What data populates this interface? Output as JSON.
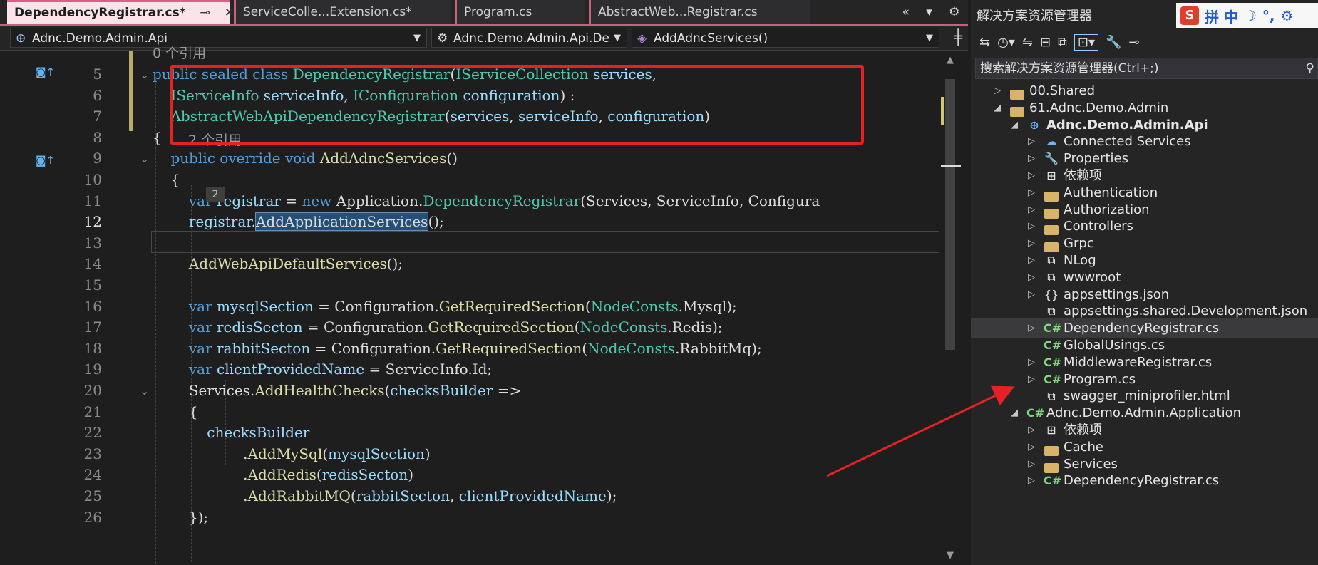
{
  "tabs": [
    {
      "label": "DependencyRegistrar.cs*",
      "active": true
    },
    {
      "label": "ServiceColle...Extension.cs*",
      "active": false
    },
    {
      "label": "Program.cs",
      "active": false
    },
    {
      "label": "AbstractWeb...Registrar.cs",
      "active": false
    }
  ],
  "nav": {
    "project": "Adnc.Demo.Admin.Api",
    "type": "Adnc.Demo.Admin.Api.De",
    "member": "AddAdncServices()"
  },
  "code": {
    "codelens_class": "0 个引用",
    "codelens_method": "2 个引用",
    "inline_hint": "2",
    "lines": [
      {
        "n": "5",
        "parts": [
          [
            "kw",
            "public sealed class "
          ],
          [
            "ty",
            "DependencyRegistrar"
          ],
          [
            "pl",
            "("
          ],
          [
            "ty",
            "IServiceCollection "
          ],
          [
            "id",
            "services"
          ],
          [
            "pl",
            ","
          ]
        ]
      },
      {
        "n": "6",
        "parts": [
          [
            "pl",
            "    "
          ],
          [
            "ty",
            "IServiceInfo "
          ],
          [
            "id",
            "serviceInfo"
          ],
          [
            "pl",
            ", "
          ],
          [
            "ty",
            "IConfiguration "
          ],
          [
            "id",
            "configuration"
          ],
          [
            "pl",
            ") :"
          ]
        ]
      },
      {
        "n": "7",
        "parts": [
          [
            "pl",
            "    "
          ],
          [
            "ty",
            "AbstractWebApiDependencyRegistrar"
          ],
          [
            "pl",
            "("
          ],
          [
            "id",
            "services"
          ],
          [
            "pl",
            ", "
          ],
          [
            "id",
            "serviceInfo"
          ],
          [
            "pl",
            ", "
          ],
          [
            "id",
            "configuration"
          ],
          [
            "pl",
            ")"
          ]
        ]
      },
      {
        "n": "8",
        "parts": [
          [
            "pl",
            "{"
          ]
        ]
      },
      {
        "n": "9",
        "parts": [
          [
            "pl",
            "    "
          ],
          [
            "kw",
            "public override void "
          ],
          [
            "mt",
            "AddAdncServices"
          ],
          [
            "pl",
            "()"
          ]
        ]
      },
      {
        "n": "10",
        "parts": [
          [
            "pl",
            "    {"
          ]
        ]
      },
      {
        "n": "11",
        "parts": [
          [
            "pl",
            "        "
          ],
          [
            "kw",
            "var "
          ],
          [
            "id",
            "registrar"
          ],
          [
            "pl",
            " = "
          ],
          [
            "kw",
            "new "
          ],
          [
            "pl",
            "Application."
          ],
          [
            "ty",
            "DependencyRegistrar"
          ],
          [
            "pl",
            "(Services, ServiceInfo, Configura"
          ]
        ]
      },
      {
        "n": "12",
        "parts": [
          [
            "pl",
            "        "
          ],
          [
            "id",
            "registrar"
          ],
          [
            "pl",
            "."
          ],
          [
            "hl",
            "AddApplicationServices"
          ],
          [
            "pl",
            "();"
          ]
        ]
      },
      {
        "n": "13",
        "parts": []
      },
      {
        "n": "14",
        "parts": [
          [
            "pl",
            "        "
          ],
          [
            "mt",
            "AddWebApiDefaultServices"
          ],
          [
            "pl",
            "();"
          ]
        ]
      },
      {
        "n": "15",
        "parts": []
      },
      {
        "n": "16",
        "parts": [
          [
            "pl",
            "        "
          ],
          [
            "kw",
            "var "
          ],
          [
            "id",
            "mysqlSection"
          ],
          [
            "pl",
            " = Configuration."
          ],
          [
            "mt",
            "GetRequiredSection"
          ],
          [
            "pl",
            "("
          ],
          [
            "ty",
            "NodeConsts"
          ],
          [
            "pl",
            ".Mysql);"
          ]
        ]
      },
      {
        "n": "17",
        "parts": [
          [
            "pl",
            "        "
          ],
          [
            "kw",
            "var "
          ],
          [
            "id",
            "redisSecton"
          ],
          [
            "pl",
            " = Configuration."
          ],
          [
            "mt",
            "GetRequiredSection"
          ],
          [
            "pl",
            "("
          ],
          [
            "ty",
            "NodeConsts"
          ],
          [
            "pl",
            ".Redis);"
          ]
        ]
      },
      {
        "n": "18",
        "parts": [
          [
            "pl",
            "        "
          ],
          [
            "kw",
            "var "
          ],
          [
            "id",
            "rabbitSecton"
          ],
          [
            "pl",
            " = Configuration."
          ],
          [
            "mt",
            "GetRequiredSection"
          ],
          [
            "pl",
            "("
          ],
          [
            "ty",
            "NodeConsts"
          ],
          [
            "pl",
            ".RabbitMq);"
          ]
        ]
      },
      {
        "n": "19",
        "parts": [
          [
            "pl",
            "        "
          ],
          [
            "kw",
            "var "
          ],
          [
            "id",
            "clientProvidedName"
          ],
          [
            "pl",
            " = ServiceInfo.Id;"
          ]
        ]
      },
      {
        "n": "20",
        "parts": [
          [
            "pl",
            "        Services."
          ],
          [
            "mt",
            "AddHealthChecks"
          ],
          [
            "pl",
            "("
          ],
          [
            "id",
            "checksBuilder"
          ],
          [
            "pl",
            " =>"
          ]
        ]
      },
      {
        "n": "21",
        "parts": [
          [
            "pl",
            "        {"
          ]
        ]
      },
      {
        "n": "22",
        "parts": [
          [
            "pl",
            "            "
          ],
          [
            "id",
            "checksBuilder"
          ]
        ]
      },
      {
        "n": "23",
        "parts": [
          [
            "pl",
            "                    ."
          ],
          [
            "mt",
            "AddMySql"
          ],
          [
            "pl",
            "("
          ],
          [
            "id",
            "mysqlSection"
          ],
          [
            "pl",
            ")"
          ]
        ]
      },
      {
        "n": "24",
        "parts": [
          [
            "pl",
            "                    ."
          ],
          [
            "mt",
            "AddRedis"
          ],
          [
            "pl",
            "("
          ],
          [
            "id",
            "redisSecton"
          ],
          [
            "pl",
            ")"
          ]
        ]
      },
      {
        "n": "25",
        "parts": [
          [
            "pl",
            "                    ."
          ],
          [
            "mt",
            "AddRabbitMQ"
          ],
          [
            "pl",
            "("
          ],
          [
            "id",
            "rabbitSecton"
          ],
          [
            "pl",
            ", "
          ],
          [
            "id",
            "clientProvidedName"
          ],
          [
            "pl",
            ");"
          ]
        ]
      },
      {
        "n": "26",
        "parts": [
          [
            "pl",
            "        });"
          ]
        ]
      }
    ]
  },
  "solution_explorer": {
    "title": "解决方案资源管理器",
    "search_placeholder": "搜索解决方案资源管理器(Ctrl+;)",
    "ime_chars": "拼 中",
    "tree": [
      {
        "label": "00.Shared",
        "depth": 0,
        "icon": "folder-icon",
        "expand": "collapsed"
      },
      {
        "label": "61.Adnc.Demo.Admin",
        "depth": 0,
        "icon": "folder-icon",
        "expand": "expanded"
      },
      {
        "label": "Adnc.Demo.Admin.Api",
        "depth": 1,
        "icon": "web-project-icon",
        "expand": "expanded",
        "bold": true
      },
      {
        "label": "Connected Services",
        "depth": 2,
        "icon": "connected-services-icon",
        "expand": "collapsed"
      },
      {
        "label": "Properties",
        "depth": 2,
        "icon": "wrench-icon",
        "expand": "collapsed"
      },
      {
        "label": "依赖项",
        "depth": 2,
        "icon": "dependencies-icon",
        "expand": "collapsed"
      },
      {
        "label": "Authentication",
        "depth": 2,
        "icon": "folder-icon",
        "expand": "collapsed"
      },
      {
        "label": "Authorization",
        "depth": 2,
        "icon": "folder-icon",
        "expand": "collapsed"
      },
      {
        "label": "Controllers",
        "depth": 2,
        "icon": "folder-icon",
        "expand": "collapsed"
      },
      {
        "label": "Grpc",
        "depth": 2,
        "icon": "folder-icon",
        "expand": "collapsed"
      },
      {
        "label": "NLog",
        "depth": 2,
        "icon": "link-folder-icon",
        "expand": "collapsed"
      },
      {
        "label": "wwwroot",
        "depth": 2,
        "icon": "link-folder-icon",
        "expand": "collapsed"
      },
      {
        "label": "appsettings.json",
        "depth": 2,
        "icon": "json-file-icon",
        "expand": "collapsed"
      },
      {
        "label": "appsettings.shared.Development.json",
        "depth": 2,
        "icon": "json-link-icon",
        "expand": "none"
      },
      {
        "label": "DependencyRegistrar.cs",
        "depth": 2,
        "icon": "csharp-file-icon",
        "expand": "collapsed",
        "selected": true
      },
      {
        "label": "GlobalUsings.cs",
        "depth": 2,
        "icon": "csharp-file-icon",
        "expand": "none"
      },
      {
        "label": "MiddlewareRegistrar.cs",
        "depth": 2,
        "icon": "csharp-file-icon",
        "expand": "collapsed"
      },
      {
        "label": "Program.cs",
        "depth": 2,
        "icon": "csharp-file-icon",
        "expand": "collapsed"
      },
      {
        "label": "swagger_miniprofiler.html",
        "depth": 2,
        "icon": "html-file-icon",
        "expand": "none"
      },
      {
        "label": "Adnc.Demo.Admin.Application",
        "depth": 1,
        "icon": "csharp-project-icon",
        "expand": "expanded"
      },
      {
        "label": "依赖项",
        "depth": 2,
        "icon": "dependencies-icon",
        "expand": "collapsed"
      },
      {
        "label": "Cache",
        "depth": 2,
        "icon": "folder-icon",
        "expand": "collapsed"
      },
      {
        "label": "Services",
        "depth": 2,
        "icon": "folder-icon",
        "expand": "collapsed"
      },
      {
        "label": "DependencyRegistrar.cs",
        "depth": 2,
        "icon": "csharp-file-icon",
        "expand": "collapsed"
      }
    ]
  },
  "colors": {
    "annotation": "#e52222",
    "tab_accent": "#e05d86",
    "keyword": "#569cd6",
    "type": "#4ec9b0"
  }
}
